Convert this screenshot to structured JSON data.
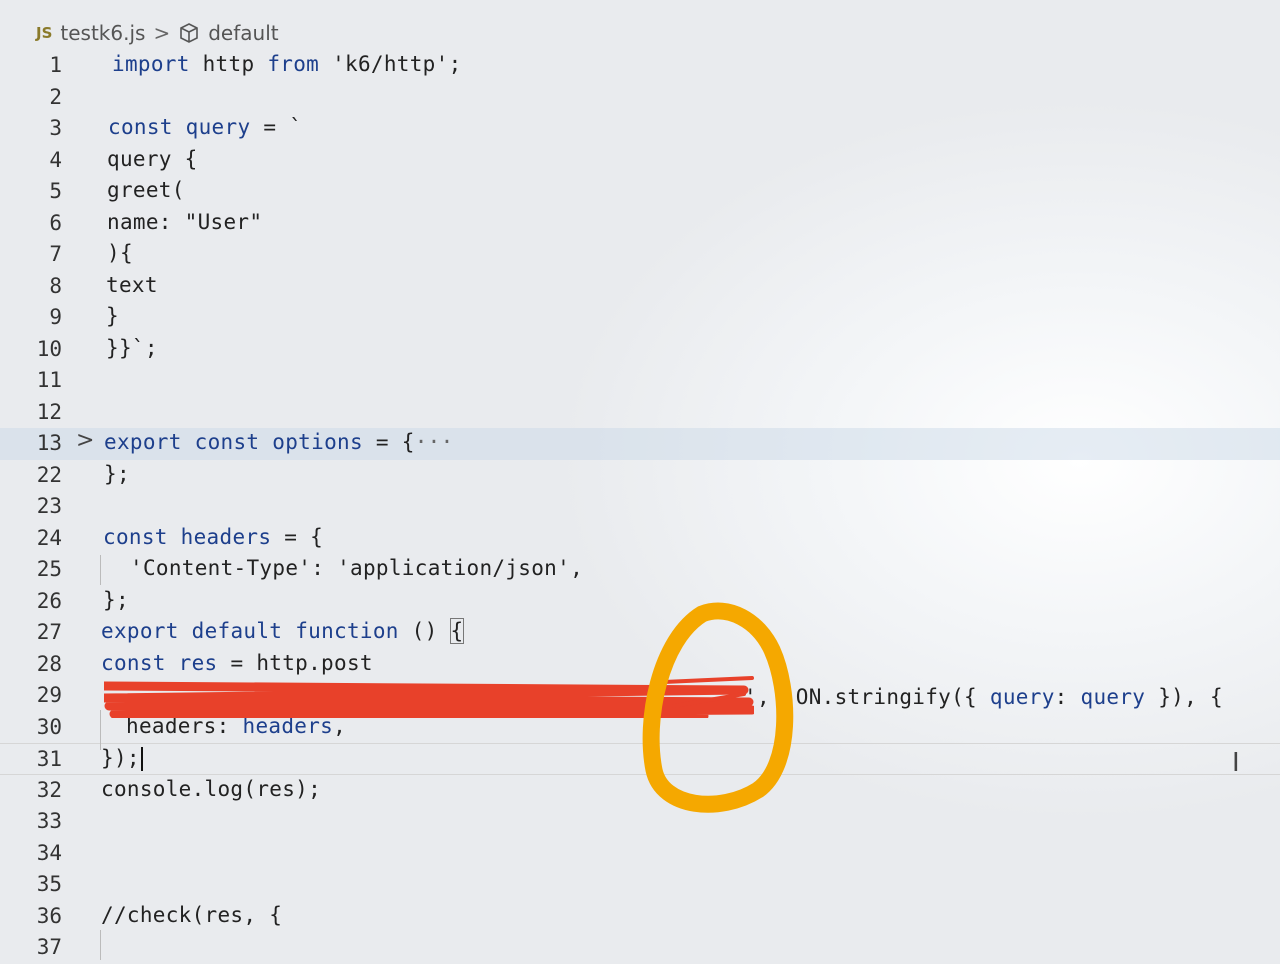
{
  "breadcrumb": {
    "file_icon": "JS",
    "file_name": "testk6.js",
    "separator": ">",
    "symbol_icon": "cube-icon",
    "symbol_name": "default"
  },
  "lines": [
    {
      "n": "1",
      "text": "import http from 'k6/http';"
    },
    {
      "n": "2",
      "text": ""
    },
    {
      "n": "3",
      "text": "const query = `"
    },
    {
      "n": "4",
      "text": "query {"
    },
    {
      "n": "5",
      "text": "greet("
    },
    {
      "n": "6",
      "text": "name: \"User\""
    },
    {
      "n": "7",
      "text": "){"
    },
    {
      "n": "8",
      "text": "text"
    },
    {
      "n": "9",
      "text": "}"
    },
    {
      "n": "10",
      "text": "}}`;"
    },
    {
      "n": "11",
      "text": ""
    },
    {
      "n": "12",
      "text": ""
    },
    {
      "n": "13",
      "text": "export const options = {···"
    },
    {
      "n": "22",
      "text": "};"
    },
    {
      "n": "23",
      "text": ""
    },
    {
      "n": "24",
      "text": "const headers = {"
    },
    {
      "n": "25",
      "text": "'Content-Type': 'application/json',"
    },
    {
      "n": "26",
      "text": "};"
    },
    {
      "n": "27",
      "text": "export default function () {"
    },
    {
      "n": "28",
      "text": "const res = http.post"
    },
    {
      "n": "29",
      "text": "',  ON.stringify({ query: query }), {"
    },
    {
      "n": "30",
      "text": "headers: headers,"
    },
    {
      "n": "31",
      "text": "});"
    },
    {
      "n": "32",
      "text": "console.log(res);"
    },
    {
      "n": "33",
      "text": ""
    },
    {
      "n": "34",
      "text": ""
    },
    {
      "n": "35",
      "text": ""
    },
    {
      "n": "36",
      "text": "//check(res, {"
    },
    {
      "n": "37",
      "text": ""
    }
  ],
  "fold_marker": ">",
  "colors": {
    "keyword": "#1d3f8c",
    "redaction": "#e8412a",
    "annotation": "#f5a800"
  }
}
